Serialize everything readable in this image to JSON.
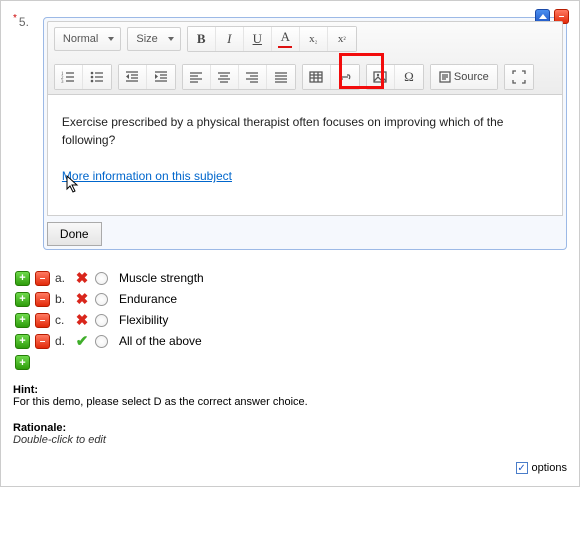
{
  "question": {
    "number": "5.",
    "required_marker": "*",
    "body_text": "Exercise prescribed by a physical therapist often focuses on improving which of the following?",
    "link_text": "More information on this subject",
    "done_label": "Done"
  },
  "toolbar": {
    "format_label": "Normal",
    "size_label": "Size",
    "source_label": "Source"
  },
  "answers": [
    {
      "letter": "a.",
      "correct": false,
      "text": "Muscle strength"
    },
    {
      "letter": "b.",
      "correct": false,
      "text": "Endurance"
    },
    {
      "letter": "c.",
      "correct": false,
      "text": "Flexibility"
    },
    {
      "letter": "d.",
      "correct": true,
      "text": "All of the above"
    }
  ],
  "hint": {
    "label": "Hint:",
    "text": "For this demo, please select D as the correct answer choice."
  },
  "rationale": {
    "label": "Rationale:",
    "placeholder": "Double-click to edit"
  },
  "bottom": {
    "options_label": "options"
  }
}
